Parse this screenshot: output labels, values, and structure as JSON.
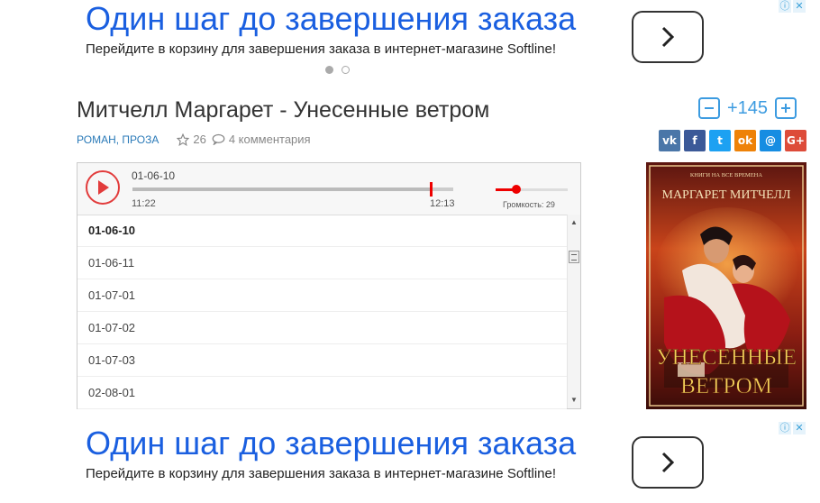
{
  "ad_top": {
    "headline": "Один шаг до завершения заказа",
    "subtext": "Перейдите в корзину для завершения заказа в интернет-магазине Softline!",
    "arrow": "chevron-right-icon",
    "flags": [
      "adchoices-icon",
      "close-icon"
    ]
  },
  "ad_bottom": {
    "headline": "Один шаг до завершения заказа",
    "subtext": "Перейдите в корзину для завершения заказа в интернет-магазине Softline!",
    "arrow": "chevron-right-icon",
    "flags": [
      "adchoices-icon",
      "close-icon"
    ]
  },
  "book": {
    "title": "Митчелл Маргарет - Унесенные ветром",
    "genre": "РОМАН, ПРОЗА",
    "rating": "26",
    "comments": "4 комментария"
  },
  "vote": {
    "count": "+145"
  },
  "social": [
    {
      "name": "vk",
      "label": "vk",
      "color": "#4a76a8"
    },
    {
      "name": "facebook",
      "label": "f",
      "color": "#3b5998"
    },
    {
      "name": "twitter",
      "label": "t",
      "color": "#1da1f2"
    },
    {
      "name": "odnoklassniki",
      "label": "ok",
      "color": "#ee8208"
    },
    {
      "name": "moimir",
      "label": "@",
      "color": "#168de2"
    },
    {
      "name": "googleplus",
      "label": "G+",
      "color": "#dd4b39"
    }
  ],
  "player": {
    "current_track": "01-06-10",
    "time_current": "11:22",
    "time_total": "12:13",
    "progress": 0.93,
    "volume_label": "Громкость: 29",
    "volume": 0.29,
    "tracks": [
      "01-06-10",
      "01-06-11",
      "01-07-01",
      "01-07-02",
      "01-07-03",
      "02-08-01"
    ]
  },
  "cover": {
    "series": "КНИГИ НА ВСЕ ВРЕМЕНА",
    "author": "МАРГАРЕТ МИТЧЕЛЛ",
    "title_line1": "УНЕСЕННЫЕ",
    "title_line2": "ВЕТРОМ"
  },
  "colors": {
    "accent": "#3c9be0",
    "ad_headline": "#1a5fe0",
    "play_red": "#e23c3c",
    "genre": "#2a7ab8"
  }
}
